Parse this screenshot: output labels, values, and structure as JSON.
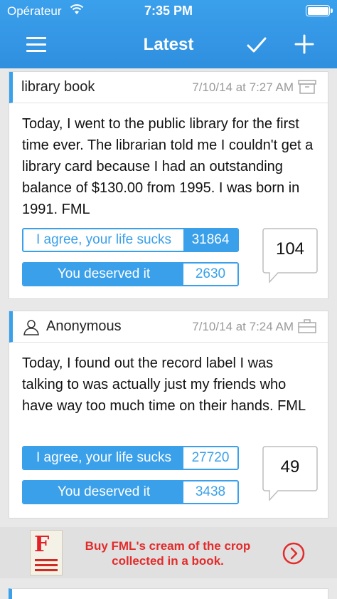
{
  "status_bar": {
    "carrier": "Opérateur",
    "time": "7:35 PM"
  },
  "nav": {
    "title": "Latest"
  },
  "posts": [
    {
      "title": "library book",
      "date": "7/10/14 at 7:27 AM",
      "body": "Today, I went to the public library for the first time ever. The librarian told me I couldn't get a library card because I had an outstanding balance of $130.00 from 1995. I was born in 1991. FML",
      "agree_label": "I agree, your life sucks",
      "agree_count": "31864",
      "deserved_label": "You deserved it",
      "deserved_count": "2630",
      "comments": "104"
    },
    {
      "title": "Anonymous",
      "date": "7/10/14 at 7:24 AM",
      "body": "Today, I found out the record label I was talking to was actually just my friends who have way too much time on their hands. FML",
      "agree_label": "I agree, your life sucks",
      "agree_count": "27720",
      "deserved_label": "You deserved it",
      "deserved_count": "3438",
      "comments": "49"
    }
  ],
  "ad": {
    "text": "Buy FML's cream of the crop collected in a book."
  },
  "colors": {
    "accent": "#3aa0ea",
    "ad_text": "#e32b2b"
  }
}
